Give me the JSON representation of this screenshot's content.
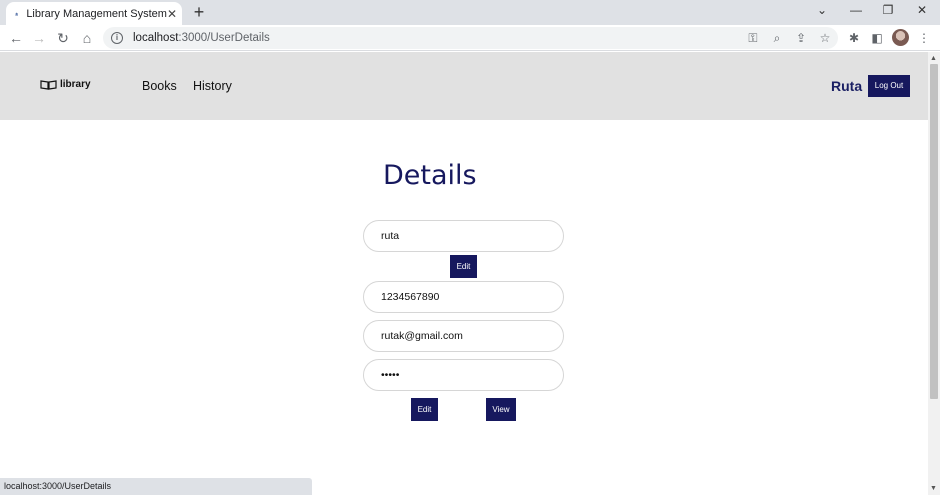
{
  "browser": {
    "tab_title": "Library Management System",
    "url_host": "localhost",
    "url_path": ":3000/UserDetails",
    "status_text": "localhost:3000/UserDetails"
  },
  "navbar": {
    "brand": "library",
    "links": [
      "Books",
      "History"
    ],
    "user_name": "Ruta",
    "logout_label": "Log Out"
  },
  "details": {
    "title": "Details",
    "name_value": "ruta",
    "edit_name_label": "Edit",
    "phone_value": "1234567890",
    "email_value": "rutak@gmail.com",
    "password_value": "•••••",
    "edit_label": "Edit",
    "view_label": "View"
  },
  "colors": {
    "accent": "#16185e",
    "navbar_bg": "#e1e1e1"
  }
}
